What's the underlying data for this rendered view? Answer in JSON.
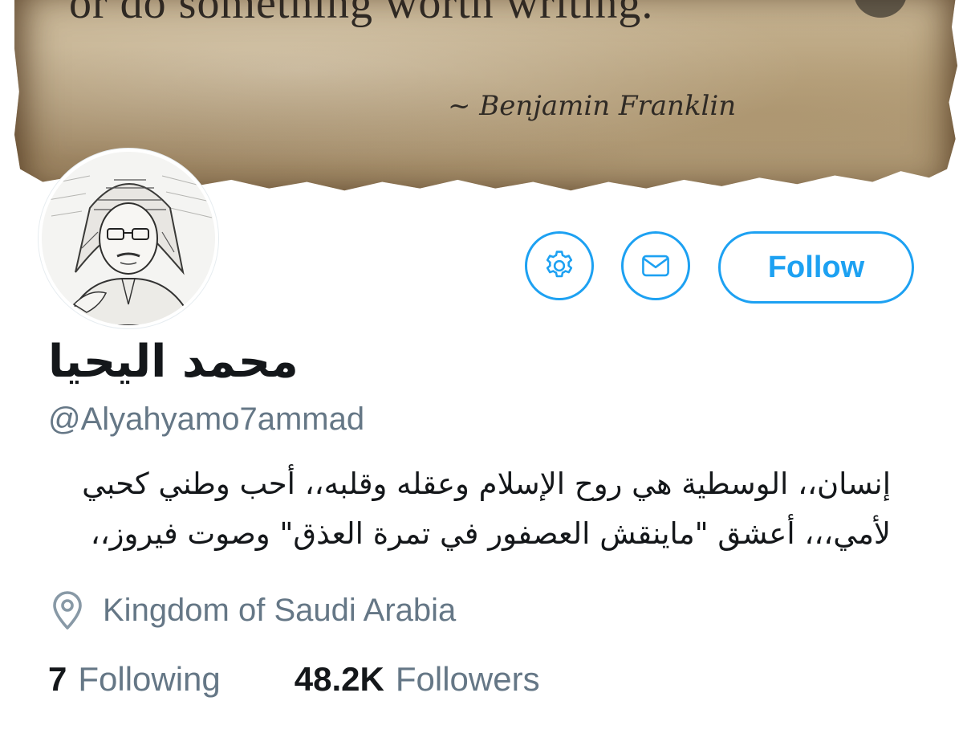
{
  "header": {
    "quote_line": "or do something worth writing.",
    "quote_author": "~ Benjamin Franklin"
  },
  "actions": {
    "settings_icon": "gear-icon",
    "message_icon": "envelope-icon",
    "follow_label": "Follow"
  },
  "profile": {
    "display_name": "محمد اليحيا",
    "handle": "@Alyahyamo7ammad",
    "bio_lines": [
      "إنسان،، الوسطية هي روح الإسلام وعقله وقلبه،، أحب وطني كحبي",
      "لأمي،،، أعشق \"ماينقش العصفور في تمرة العذق\" وصوت فيروز،،"
    ],
    "location_icon": "map-pin-icon",
    "location": "Kingdom of Saudi Arabia"
  },
  "stats": {
    "following_count": "7",
    "following_label": "Following",
    "followers_count": "48.2K",
    "followers_label": "Followers"
  },
  "colors": {
    "accent": "#1da1f2",
    "text_primary": "#14171a",
    "text_secondary": "#657786"
  }
}
